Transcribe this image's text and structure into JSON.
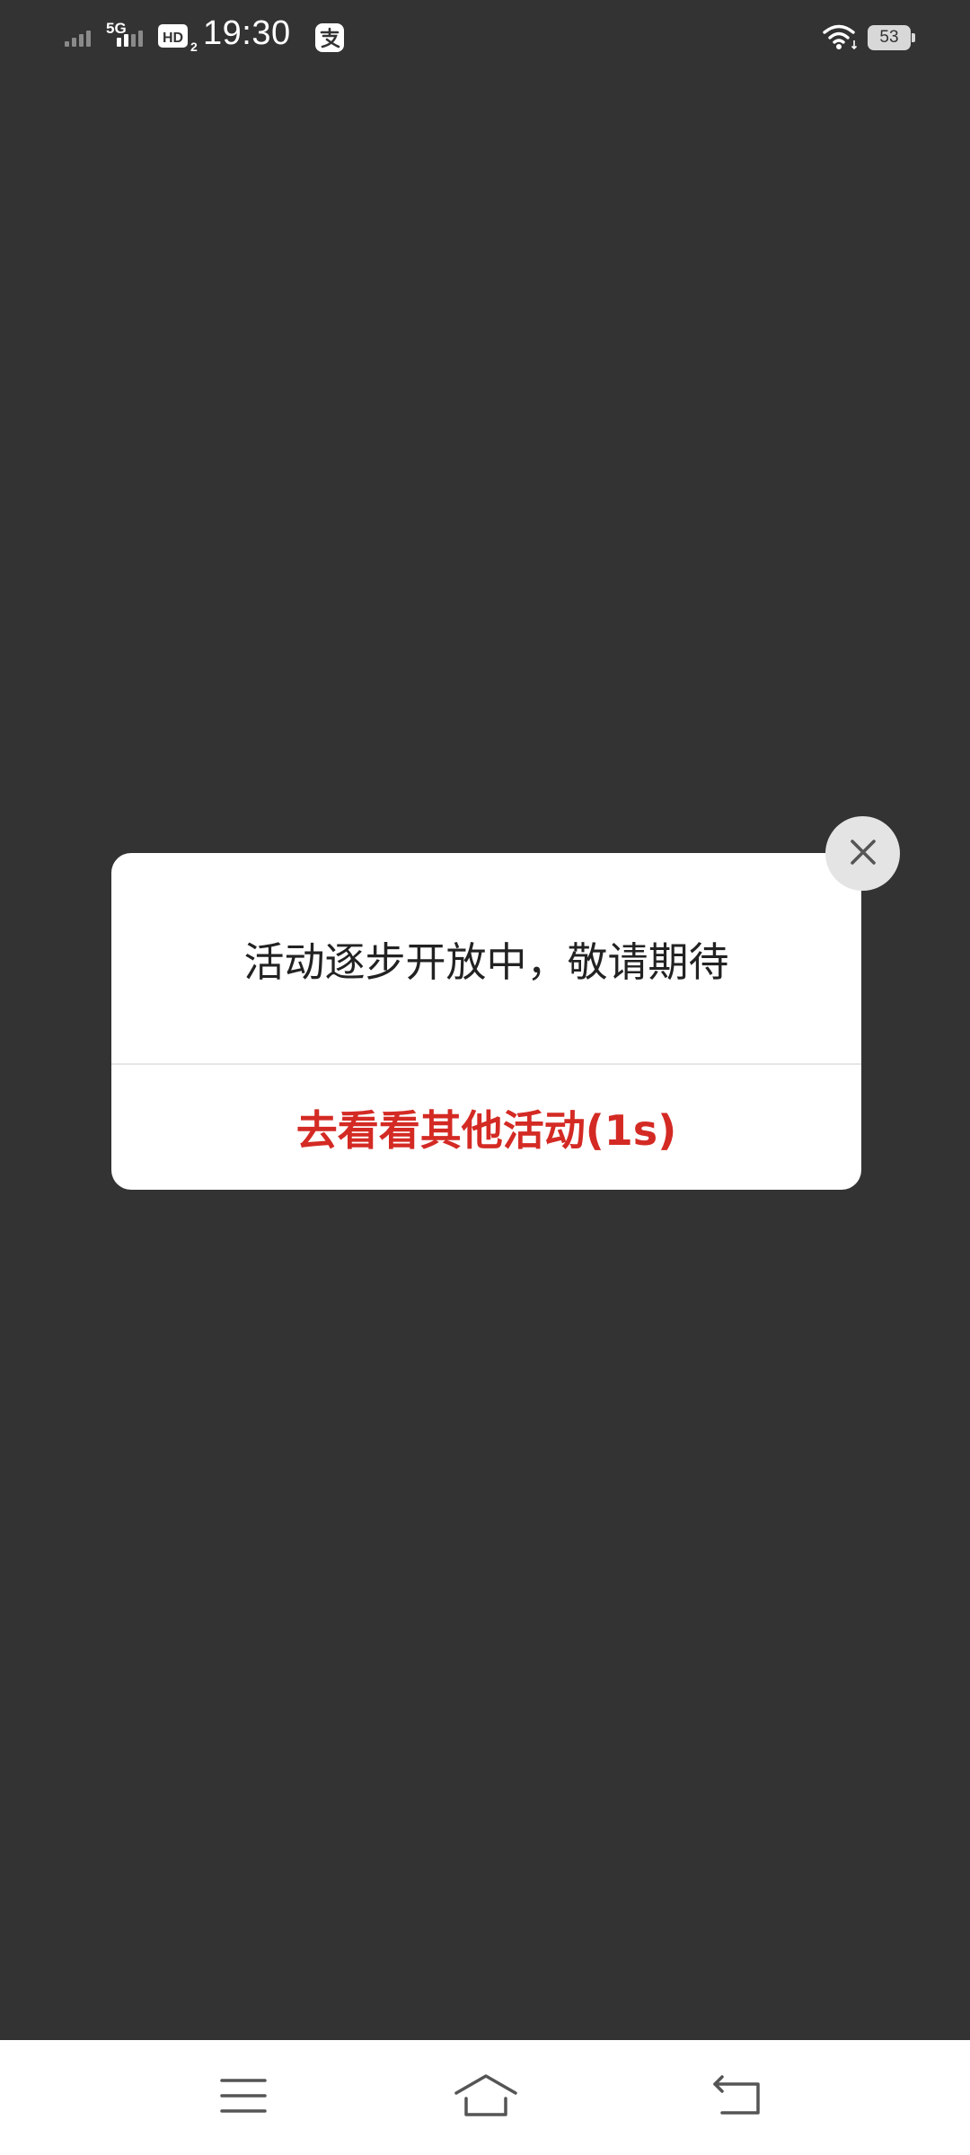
{
  "status_bar": {
    "time": "19:30",
    "network_type": "5G",
    "battery_level": "53",
    "icons": [
      "signal-icon",
      "signal-icon",
      "hd-icon",
      "alipay-icon",
      "wifi-icon",
      "battery-icon"
    ]
  },
  "dialog": {
    "message": "活动逐步开放中，敬请期待",
    "action_label": "去看看其他活动(1s)",
    "close_icon": "close-icon"
  },
  "nav_bar": {
    "icons": [
      "menu-icon",
      "home-icon",
      "back-icon"
    ]
  },
  "colors": {
    "overlay": "#333333",
    "dialog_background": "#ffffff",
    "action_text": "#d42a24",
    "message_text": "#222222",
    "close_button": "#e4e4e4"
  }
}
